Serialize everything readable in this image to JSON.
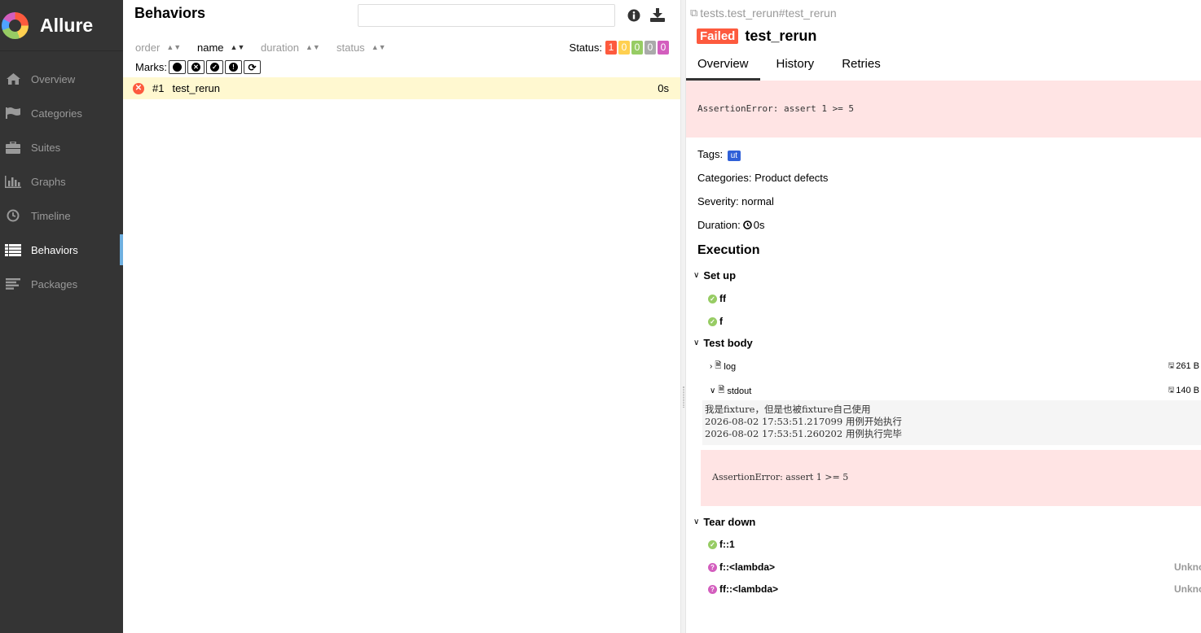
{
  "brand": {
    "name": "Allure"
  },
  "sidebar": {
    "items": [
      {
        "label": "Overview",
        "icon": "home-icon"
      },
      {
        "label": "Categories",
        "icon": "flag-icon"
      },
      {
        "label": "Suites",
        "icon": "briefcase-icon"
      },
      {
        "label": "Graphs",
        "icon": "bar-chart-icon"
      },
      {
        "label": "Timeline",
        "icon": "clock-icon"
      },
      {
        "label": "Behaviors",
        "icon": "list-icon",
        "active": true
      },
      {
        "label": "Packages",
        "icon": "align-left-icon"
      }
    ]
  },
  "behaviors": {
    "title": "Behaviors",
    "search": {
      "placeholder": "",
      "value": ""
    },
    "sort": {
      "order": "order",
      "name": "name",
      "duration": "duration",
      "status": "status"
    },
    "status_label": "Status:",
    "status_counts": [
      {
        "value": "1",
        "color": "#fd5a3e",
        "status": "failed"
      },
      {
        "value": "0",
        "color": "#ffd050",
        "status": "broken"
      },
      {
        "value": "0",
        "color": "#97cc64",
        "status": "passed"
      },
      {
        "value": "0",
        "color": "#aaaaaa",
        "status": "skipped"
      },
      {
        "value": "0",
        "color": "#d35ebe",
        "status": "unknown"
      }
    ],
    "marks_label": "Marks:",
    "rows": [
      {
        "num": "#1",
        "name": "test_rerun",
        "duration": "0s",
        "status": "failed"
      }
    ]
  },
  "test": {
    "path": "tests.test_rerun#test_rerun",
    "status_label": "Failed",
    "title": "test_rerun",
    "tabs": [
      "Overview",
      "History",
      "Retries"
    ],
    "error": "AssertionError: assert 1 >= 5",
    "tags_label": "Tags:",
    "tags": [
      "ut"
    ],
    "categories": "Categories: Product defects",
    "severity": "Severity: normal",
    "duration_label": "Duration:",
    "duration": "0s",
    "execution_title": "Execution",
    "setup": {
      "title": "Set up",
      "steps": [
        "ff",
        "f"
      ]
    },
    "body": {
      "title": "Test body",
      "attachments": [
        {
          "name": "log",
          "size": "261 B"
        },
        {
          "name": "stdout",
          "size": "140 B"
        }
      ],
      "stdout": "我是fixture，但是也被fixture自己使用\n2026-08-02 17:53:51.217099 用例开始执行\n2026-08-02 17:53:51.260202 用例执行完毕",
      "error": "AssertionError: assert 1 >= 5"
    },
    "teardown": {
      "title": "Tear down",
      "steps": [
        {
          "name": "f::1",
          "status": "passed"
        },
        {
          "name": "f::<lambda>",
          "status": "unknown",
          "label": "Unkno"
        },
        {
          "name": "ff::<lambda>",
          "status": "unknown",
          "label": "Unkno"
        }
      ]
    }
  }
}
